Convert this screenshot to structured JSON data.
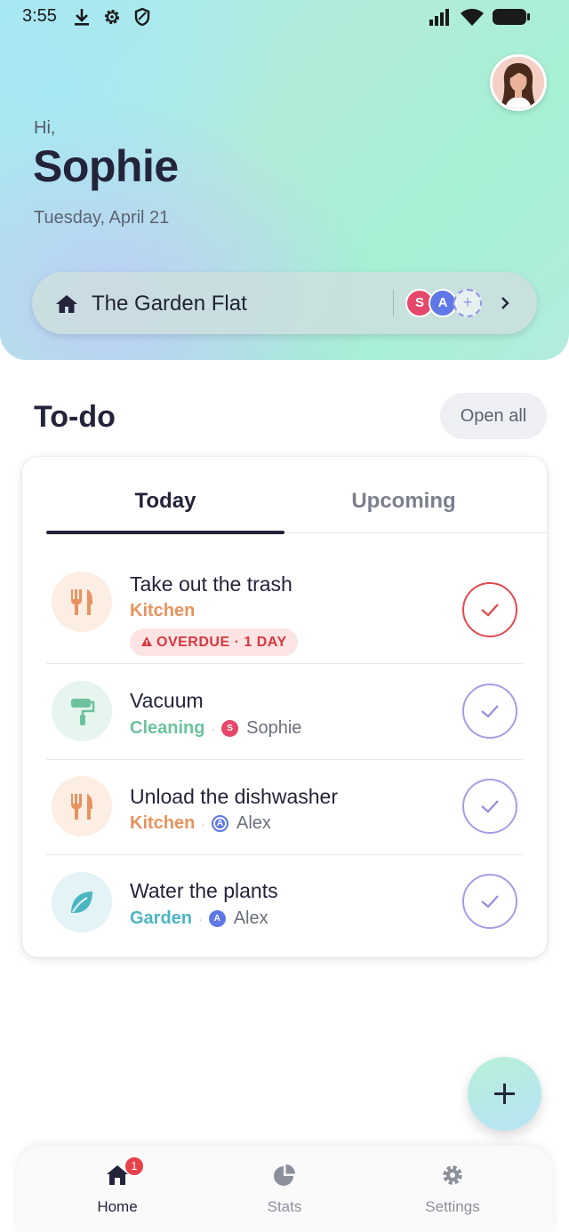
{
  "status_bar": {
    "time": "3:55"
  },
  "header": {
    "greeting": "Hi,",
    "user_name": "Sophie",
    "date": "Tuesday, April 21",
    "home": {
      "name": "The Garden Flat",
      "members": [
        {
          "initial": "S",
          "color": "#e5486a"
        },
        {
          "initial": "A",
          "color": "#5f78e6"
        }
      ],
      "add_member_symbol": "+"
    }
  },
  "todo": {
    "title": "To-do",
    "open_all_label": "Open all",
    "tabs": [
      {
        "label": "Today",
        "active": true
      },
      {
        "label": "Upcoming",
        "active": false
      }
    ],
    "tasks": [
      {
        "title": "Take out the trash",
        "category": "Kitchen",
        "category_color": "#e8935f",
        "icon": "fork-knife-icon",
        "overdue_label": "OVERDUE · 1 DAY",
        "assignee": null
      },
      {
        "title": "Vacuum",
        "category": "Cleaning",
        "category_color": "#6cc29c",
        "icon": "paint-roller-icon",
        "assignee": {
          "initial": "S",
          "name": "Sophie",
          "color": "#e5486a"
        }
      },
      {
        "title": "Unload the dishwasher",
        "category": "Kitchen",
        "category_color": "#e8935f",
        "icon": "fork-knife-icon",
        "assignee": {
          "initial": "A",
          "name": "Alex",
          "color": "#5f78e6"
        }
      },
      {
        "title": "Water the plants",
        "category": "Garden",
        "category_color": "#4cb5c2",
        "icon": "leaf-icon",
        "assignee": {
          "initial": "A",
          "name": "Alex",
          "color": "#5f78e6"
        }
      }
    ]
  },
  "fab": {
    "icon": "plus-icon"
  },
  "bottom_nav": {
    "items": [
      {
        "label": "Home",
        "icon": "home-icon",
        "badge": "1",
        "active": true
      },
      {
        "label": "Stats",
        "icon": "pie-chart-icon",
        "active": false
      },
      {
        "label": "Settings",
        "icon": "gear-icon",
        "active": false
      }
    ]
  }
}
